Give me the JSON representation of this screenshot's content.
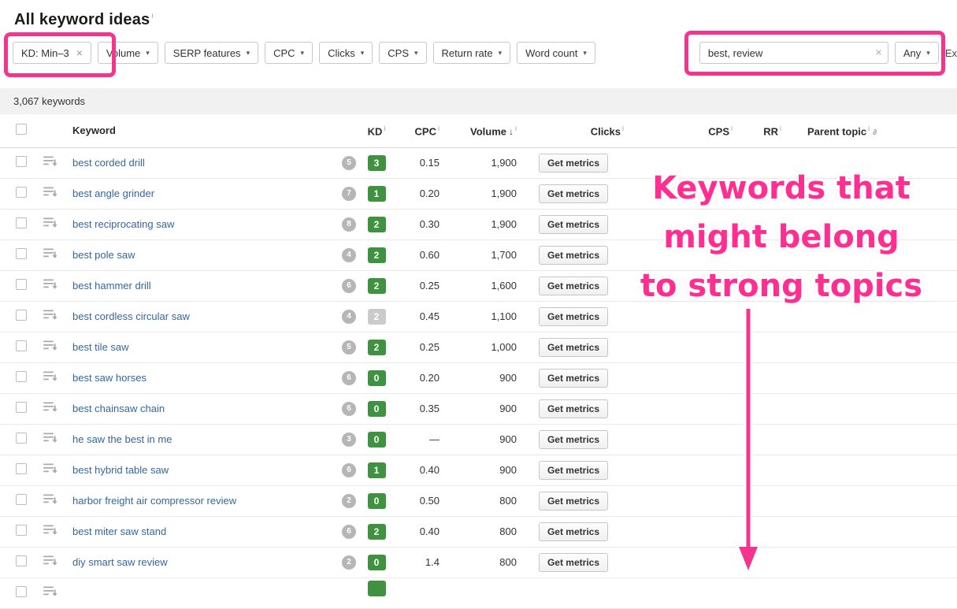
{
  "page": {
    "title": "All keyword ideas"
  },
  "icons": {
    "info": "i",
    "caret": "▾",
    "sort_desc": "↓",
    "clear": "×",
    "parent_topic_chart": "∂"
  },
  "filters": {
    "kd_chip": "KD: Min–3",
    "dropdowns": [
      "Volume",
      "SERP features",
      "CPC",
      "Clicks",
      "CPS",
      "Return rate",
      "Word count"
    ],
    "search_value": "best, review",
    "match_label": "Any",
    "exclude_clipped": "Ex"
  },
  "summary": {
    "count": "3,067 keywords"
  },
  "table": {
    "headers": {
      "keyword": "Keyword",
      "kd": "KD",
      "cpc": "CPC",
      "volume": "Volume",
      "clicks": "Clicks",
      "cps": "CPS",
      "rr": "RR",
      "parent_topic": "Parent topic"
    },
    "get_metrics_label": "Get metrics",
    "rows": [
      {
        "keyword": "best corded drill",
        "group": "5",
        "kd": "3",
        "kd_variant": "green",
        "cpc": "0.15",
        "volume": "1,900"
      },
      {
        "keyword": "best angle grinder",
        "group": "7",
        "kd": "1",
        "kd_variant": "green",
        "cpc": "0.20",
        "volume": "1,900"
      },
      {
        "keyword": "best reciprocating saw",
        "group": "8",
        "kd": "2",
        "kd_variant": "green",
        "cpc": "0.30",
        "volume": "1,900"
      },
      {
        "keyword": "best pole saw",
        "group": "4",
        "kd": "2",
        "kd_variant": "green",
        "cpc": "0.60",
        "volume": "1,700"
      },
      {
        "keyword": "best hammer drill",
        "group": "6",
        "kd": "2",
        "kd_variant": "green",
        "cpc": "0.25",
        "volume": "1,600"
      },
      {
        "keyword": "best cordless circular saw",
        "group": "4",
        "kd": "2",
        "kd_variant": "gray",
        "cpc": "0.45",
        "volume": "1,100"
      },
      {
        "keyword": "best tile saw",
        "group": "5",
        "kd": "2",
        "kd_variant": "green",
        "cpc": "0.25",
        "volume": "1,000"
      },
      {
        "keyword": "best saw horses",
        "group": "6",
        "kd": "0",
        "kd_variant": "green",
        "cpc": "0.20",
        "volume": "900"
      },
      {
        "keyword": "best chainsaw chain",
        "group": "6",
        "kd": "0",
        "kd_variant": "green",
        "cpc": "0.35",
        "volume": "900"
      },
      {
        "keyword": "he saw the best in me",
        "group": "3",
        "kd": "0",
        "kd_variant": "green",
        "cpc": "—",
        "volume": "900"
      },
      {
        "keyword": "best hybrid table saw",
        "group": "6",
        "kd": "1",
        "kd_variant": "green",
        "cpc": "0.40",
        "volume": "900"
      },
      {
        "keyword": "harbor freight air compressor review",
        "group": "2",
        "kd": "0",
        "kd_variant": "green",
        "cpc": "0.50",
        "volume": "800"
      },
      {
        "keyword": "best miter saw stand",
        "group": "6",
        "kd": "2",
        "kd_variant": "green",
        "cpc": "0.40",
        "volume": "800"
      },
      {
        "keyword": "diy smart saw review",
        "group": "2",
        "kd": "0",
        "kd_variant": "green",
        "cpc": "1.4",
        "volume": "800"
      },
      {
        "keyword": "",
        "group": "",
        "kd": "",
        "kd_variant": "green",
        "cpc": "",
        "volume": "",
        "partial": true
      }
    ]
  },
  "annotation": {
    "lines": [
      "Keywords that",
      "might belong",
      "to strong topics"
    ]
  },
  "colors": {
    "accent_pink": "#f5348e",
    "annotation_pink": "#ff2f92",
    "kd_green": "#3f9340",
    "kd_gray": "#cbcbcb",
    "link_blue": "#35669e"
  }
}
